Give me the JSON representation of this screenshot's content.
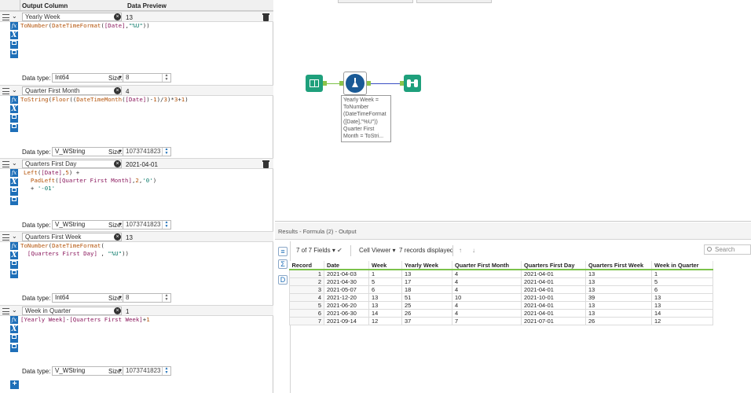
{
  "formula_panel": {
    "header": {
      "output_column": "Output Column",
      "data_preview": "Data Preview"
    },
    "formulas": [
      {
        "name": "Yearly Week",
        "preview": "13",
        "data_type": "Int64",
        "size": "8",
        "expression": "ToNumber(DateTimeFormat([Date],\"%U\"))"
      },
      {
        "name": "Quarter First Month",
        "preview": "4",
        "data_type": "V_WString",
        "size": "1073741823",
        "expression": "ToString(Floor((DateTimeMonth([Date])-1)/3)*3+1)"
      },
      {
        "name": "Quarters First Day",
        "preview": "2021-04-01",
        "data_type": "V_WString",
        "size": "1073741823",
        "expression": "Left([Date],5) +\n  PadLeft([Quarter First Month],2,'0')\n  + '-01'"
      },
      {
        "name": "Quarters First Week",
        "preview": "13",
        "data_type": "Int64",
        "size": "8",
        "expression": "ToNumber(DateTimeFormat(\n  [Quarters First Day] , \"%U\"))"
      },
      {
        "name": "Week in Quarter",
        "preview": "1",
        "data_type": "V_WString",
        "size": "1073741823",
        "expression": "[Yearly Week]-[Quarters First Week]+1"
      }
    ],
    "data_type_label": "Data type:",
    "size_label": "Size:",
    "add_label": "+"
  },
  "canvas": {
    "annotation": "Yearly Week =\nToNumber\n(DateTimeFormat\n([Date],\"%U\"))\nQuarter First\nMonth = ToStri..."
  },
  "results": {
    "title": "Results - Formula (2) - Output",
    "fields": "7 of 7 Fields",
    "viewer": "Cell Viewer",
    "records": "7 records displayed",
    "search_placeholder": "Search",
    "columns": [
      "Record",
      "Date",
      "Week",
      "Yearly Week",
      "Quarter First Month",
      "Quarters First Day",
      "Quarters First Week",
      "Week in Quarter"
    ],
    "rows": [
      [
        "1",
        "2021-04-03",
        "1",
        "13",
        "4",
        "2021-04-01",
        "13",
        "1"
      ],
      [
        "2",
        "2021-04-30",
        "5",
        "17",
        "4",
        "2021-04-01",
        "13",
        "5"
      ],
      [
        "3",
        "2021-05-07",
        "6",
        "18",
        "4",
        "2021-04-01",
        "13",
        "6"
      ],
      [
        "4",
        "2021-12-20",
        "13",
        "51",
        "10",
        "2021-10-01",
        "39",
        "13"
      ],
      [
        "5",
        "2021-06-20",
        "13",
        "25",
        "4",
        "2021-04-01",
        "13",
        "13"
      ],
      [
        "6",
        "2021-06-30",
        "14",
        "26",
        "4",
        "2021-04-01",
        "13",
        "14"
      ],
      [
        "7",
        "2021-09-14",
        "12",
        "37",
        "7",
        "2021-07-01",
        "26",
        "12"
      ]
    ]
  },
  "colors": {
    "accent": "#1e6fb8",
    "tool_green": "#1fa07c",
    "formula_blue": "#1a5a96",
    "header_underline": "#7cc24a"
  }
}
